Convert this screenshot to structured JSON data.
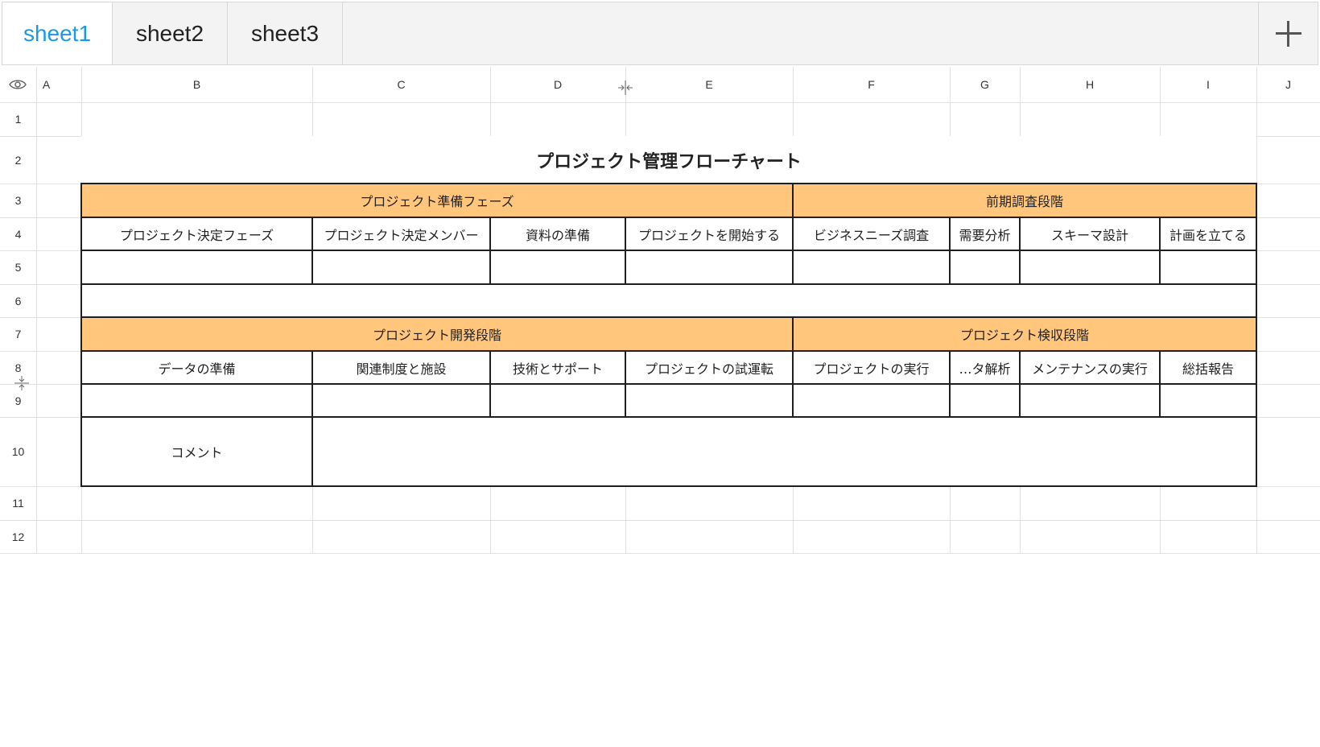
{
  "tabs": [
    {
      "label": "sheet1",
      "active": true
    },
    {
      "label": "sheet2",
      "active": false
    },
    {
      "label": "sheet3",
      "active": false
    }
  ],
  "add_sheet_icon": "plus-icon",
  "columns": [
    "A",
    "B",
    "C",
    "D",
    "E",
    "F",
    "G",
    "H",
    "I",
    "J"
  ],
  "rows": [
    "1",
    "2",
    "3",
    "4",
    "5",
    "6",
    "7",
    "8",
    "9",
    "10",
    "11",
    "12"
  ],
  "colors": {
    "header_fill": "#ffc67c",
    "active_tab": "#1a9ae6",
    "border": "#1f1f1f",
    "gridline": "#e2e2e2"
  },
  "flowchart": {
    "title": "プロジェクト管理フローチャート",
    "phase1": "プロジェクト準備フェーズ",
    "phase2": "前期調査段階",
    "phase3": "プロジェクト開発段階",
    "phase4": "プロジェクト検収段階",
    "row4": [
      "プロジェクト決定フェーズ",
      "プロジェクト決定メンバー",
      "資料の準備",
      "プロジェクトを開始する",
      "ビジネスニーズ調査",
      "需要分析",
      "スキーマ設計",
      "計画を立てる"
    ],
    "row8": [
      "データの準備",
      "関連制度と施設",
      "技術とサポート",
      "プロジェクトの試運転",
      "プロジェクトの実行",
      "…タ解析",
      "メンテナンスの実行",
      "総括報告"
    ],
    "comment_label": "コメント"
  }
}
